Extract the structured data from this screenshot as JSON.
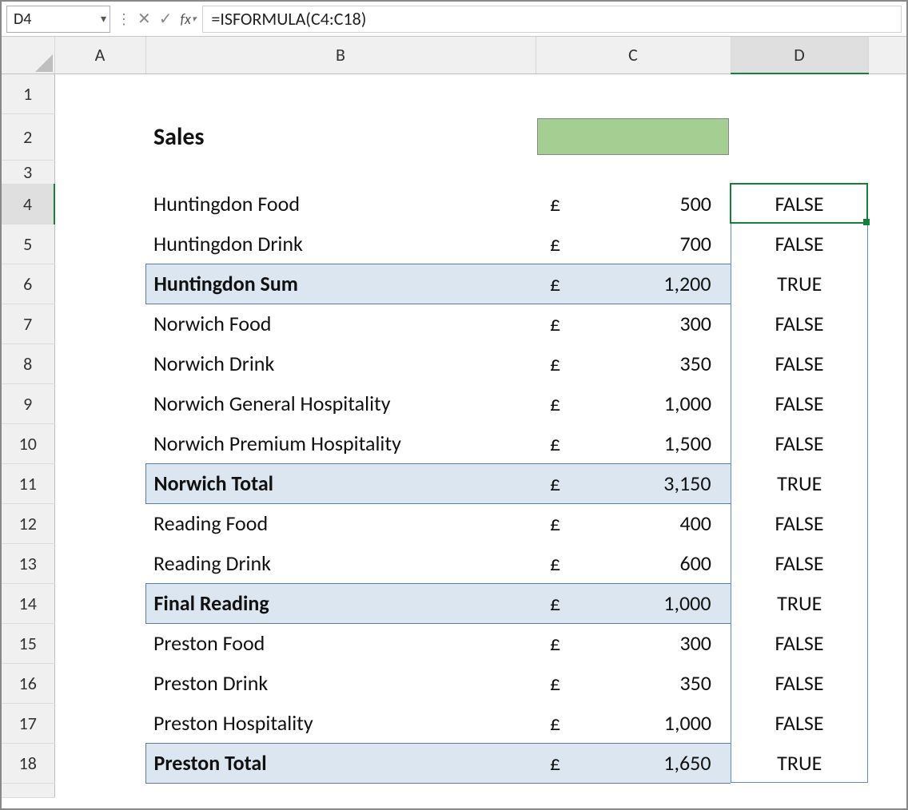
{
  "nameBox": {
    "value": "D4"
  },
  "formulaBar": {
    "value": "=ISFORMULA(C4:C18)"
  },
  "columns": [
    "A",
    "B",
    "C",
    "D"
  ],
  "activeColumn": "D",
  "activeRow": 4,
  "rowNumbers": [
    1,
    2,
    3,
    4,
    5,
    6,
    7,
    8,
    9,
    10,
    11,
    12,
    13,
    14,
    15,
    16,
    17,
    18
  ],
  "titleCell": {
    "row": 2,
    "col": "B",
    "text": "Sales"
  },
  "currencySymbol": "£",
  "rows": [
    {
      "row": 4,
      "label": "Huntingdon Food",
      "amount": "500",
      "result": "FALSE",
      "highlight": false
    },
    {
      "row": 5,
      "label": "Huntingdon Drink",
      "amount": "700",
      "result": "FALSE",
      "highlight": false
    },
    {
      "row": 6,
      "label": "Huntingdon Sum",
      "amount": "1,200",
      "result": "TRUE",
      "highlight": true
    },
    {
      "row": 7,
      "label": "Norwich Food",
      "amount": "300",
      "result": "FALSE",
      "highlight": false
    },
    {
      "row": 8,
      "label": "Norwich Drink",
      "amount": "350",
      "result": "FALSE",
      "highlight": false
    },
    {
      "row": 9,
      "label": "Norwich General Hospitality",
      "amount": "1,000",
      "result": "FALSE",
      "highlight": false
    },
    {
      "row": 10,
      "label": "Norwich Premium Hospitality",
      "amount": "1,500",
      "result": "FALSE",
      "highlight": false
    },
    {
      "row": 11,
      "label": "Norwich Total",
      "amount": "3,150",
      "result": "TRUE",
      "highlight": true
    },
    {
      "row": 12,
      "label": "Reading Food",
      "amount": "400",
      "result": "FALSE",
      "highlight": false
    },
    {
      "row": 13,
      "label": "Reading Drink",
      "amount": "600",
      "result": "FALSE",
      "highlight": false
    },
    {
      "row": 14,
      "label": "Final Reading",
      "amount": "1,000",
      "result": "TRUE",
      "highlight": true
    },
    {
      "row": 15,
      "label": "Preston Food",
      "amount": "300",
      "result": "FALSE",
      "highlight": false
    },
    {
      "row": 16,
      "label": "Preston Drink",
      "amount": "350",
      "result": "FALSE",
      "highlight": false
    },
    {
      "row": 17,
      "label": "Preston Hospitality",
      "amount": "1,000",
      "result": "FALSE",
      "highlight": false
    },
    {
      "row": 18,
      "label": "Preston Total",
      "amount": "1,650",
      "result": "TRUE",
      "highlight": true
    }
  ]
}
